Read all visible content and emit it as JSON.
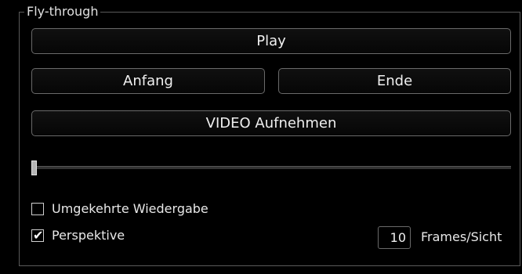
{
  "group": {
    "title": "Fly-through"
  },
  "buttons": {
    "play": "Play",
    "anfang": "Anfang",
    "ende": "Ende",
    "video": "VIDEO Aufnehmen"
  },
  "slider": {
    "value_fraction": 0.0
  },
  "options": {
    "reverse_label": "Umgekehrte Wiedergabe",
    "reverse_checked": false,
    "perspective_label": "Perspektive",
    "perspective_checked": true,
    "checkmark_glyph": "✔"
  },
  "frames": {
    "value": "10",
    "label": "Frames/Sicht"
  },
  "colors": {
    "background": "#000000",
    "text": "#e8e8e8",
    "border": "#6a6a6a",
    "slider_handle": "#b5b5b5"
  }
}
